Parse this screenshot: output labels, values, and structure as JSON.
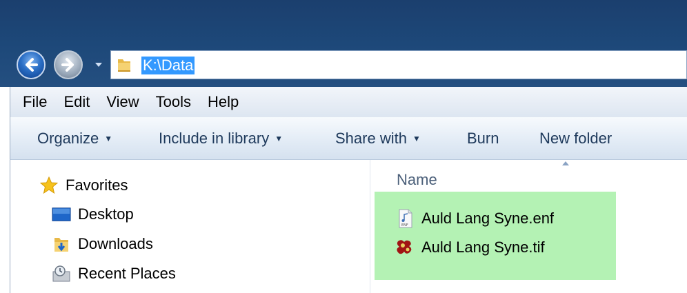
{
  "address": {
    "path": "K:\\Data",
    "folder_icon": "folder-icon"
  },
  "navigation": {
    "back_icon": "back-arrow-icon",
    "forward_icon": "forward-arrow-icon",
    "recent_icon": "recent-pages-dropdown-icon"
  },
  "menu": {
    "items": [
      "File",
      "Edit",
      "View",
      "Tools",
      "Help"
    ]
  },
  "toolbar": {
    "organize": "Organize",
    "include_in_library": "Include in library",
    "share_with": "Share with",
    "burn": "Burn",
    "new_folder": "New folder"
  },
  "nav_pane": {
    "items": [
      {
        "label": "Favorites",
        "icon": "star-icon"
      },
      {
        "label": "Desktop",
        "icon": "desktop-icon"
      },
      {
        "label": "Downloads",
        "icon": "downloads-folder-icon"
      },
      {
        "label": "Recent Places",
        "icon": "recent-places-icon"
      }
    ]
  },
  "content": {
    "column_name": "Name",
    "files": [
      {
        "name": "Auld Lang Syne.enf",
        "icon": "audio-file-icon"
      },
      {
        "name": "Auld Lang Syne.tif",
        "icon": "image-file-icon"
      }
    ]
  },
  "colors": {
    "title_bar": "#1d4879",
    "selection_highlight": "#3399ff",
    "file_area_highlight": "#b4f2b4",
    "toolbar_text": "#1e395b"
  }
}
